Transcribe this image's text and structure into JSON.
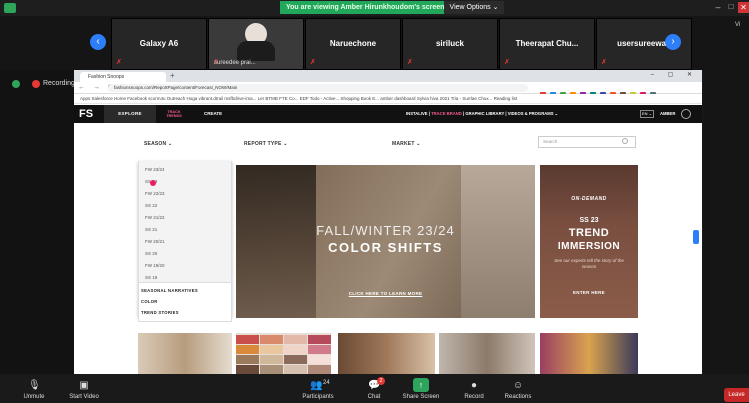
{
  "zoom": {
    "share_banner": "You are viewing Amber Hirunkhoudom's screen",
    "view_options": "View Options ⌄",
    "recording": "Recording",
    "right_label": "Vi",
    "self_view_name": "sureedee prai...",
    "participants_strip": [
      "Galaxy A6",
      "",
      "Naruechone",
      "siriluck",
      "Theerapat Chu...",
      "usersureewan"
    ],
    "toolbar": {
      "unmute": "Unmute",
      "start_video": "Start Video",
      "participants": "Participants",
      "participants_count": "24",
      "chat": "Chat",
      "chat_badge": "2",
      "share_screen": "Share Screen",
      "record": "Record",
      "reactions": "Reactions",
      "leave": "Leave"
    }
  },
  "browser": {
    "tab_title": "Fashion Snoops",
    "url": "fashionsnoops.com/ReportPage/content/Forecast_NOW/Main",
    "bookmarks": "Apps  Salesforce  Home  Facebook  scorm4u  Outreach  Hoga  vibrant.dtrail  msfbdrive-ima...  Ler BTMB FTE Co...  EDF Todo - Active...  Shopping Book E...  amber dashboard  Sylvia hiva 2021  Tria - Surrlae Chux...  Reading list"
  },
  "site": {
    "logo": "FS",
    "nav_explore": "EXPLORE",
    "nav_track": "TRACK TRENDS",
    "nav_create": "CREATE",
    "header_right_1": "INSTALIVE",
    "header_right_2": "TRACE BRAND",
    "header_right_3": "GRAPHIC LIBRARY",
    "header_right_4": "VIDEOS & PROGRAMS ⌄",
    "lang": "EN ⌄",
    "user": "AMBER",
    "filters": {
      "season": "SEASON ⌄",
      "report_type": "REPORT TYPE ⌄",
      "market": "MARKET ⌄",
      "search_placeholder": "Search"
    },
    "season_options": [
      "FW 23/24",
      "SS 23",
      "FW 22/23",
      "SS 22",
      "FW 21/22",
      "SS 21",
      "FW 20/21",
      "SS 20",
      "FW 19/20",
      "SS 19"
    ],
    "season_categories": [
      "SEASONAL NARRATIVES",
      "COLOR",
      "TREND STORIES"
    ],
    "hero": {
      "title_line1": "FALL/WINTER 23/24",
      "title_line2": "COLOR SHIFTS",
      "cta": "CLICK HERE TO LEARN MORE"
    },
    "promo": {
      "tag": "ON-DEMAND",
      "season": "SS 23",
      "title1": "TREND",
      "title2": "IMMERSION",
      "subtitle": "See our experts tell the story of the season",
      "cta": "ENTER HERE"
    }
  }
}
